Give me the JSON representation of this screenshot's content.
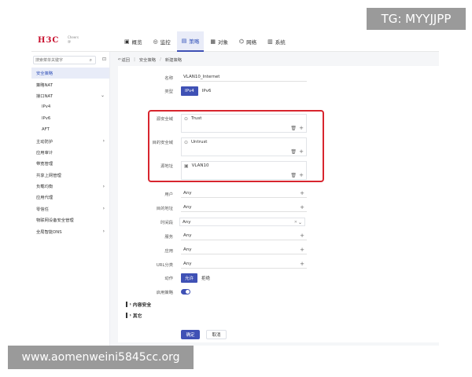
{
  "brand": {
    "logo": "H3C",
    "sub1": "Cheers",
    "sub2": "@"
  },
  "nav": [
    {
      "icon": "▣",
      "label": "概览"
    },
    {
      "icon": "◎",
      "label": "监控"
    },
    {
      "icon": "▤",
      "label": "策略"
    },
    {
      "icon": "▦",
      "label": "对象"
    },
    {
      "icon": "⌬",
      "label": "网络"
    },
    {
      "icon": "▥",
      "label": "系统"
    }
  ],
  "sidebar": {
    "search_placeholder": "搜索菜单关键字",
    "items": [
      {
        "label": "安全策略"
      },
      {
        "label": "策略NAT"
      },
      {
        "label": "接口NAT"
      },
      {
        "label": "IPv4"
      },
      {
        "label": "IPv6"
      },
      {
        "label": "AFT"
      },
      {
        "label": "主动防护"
      },
      {
        "label": "应用审计"
      },
      {
        "label": "带宽管理"
      },
      {
        "label": "共享上网管理"
      },
      {
        "label": "负载均衡"
      },
      {
        "label": "应用代理"
      },
      {
        "label": "零信任"
      },
      {
        "label": "物联网设备安全管理"
      },
      {
        "label": "全局智能DNS"
      }
    ]
  },
  "breadcrumb": {
    "back": "返回",
    "parent": "安全策略",
    "current": "新建策略"
  },
  "form": {
    "name_label": "名称",
    "name_value": "VLAN10_Internet",
    "type_label": "类型",
    "type_opt1": "IPv4",
    "type_opt2": "IPv6",
    "src_zone_label": "源安全域",
    "src_zone_value": "Trust",
    "dst_zone_label": "目的安全域",
    "dst_zone_value": "Untrust",
    "src_addr_label": "源地址",
    "src_addr_value": "VLAN10",
    "user_label": "用户",
    "user_value": "Any",
    "dst_addr_label": "目的地址",
    "dst_addr_value": "Any",
    "time_label": "时间段",
    "time_value": "Any",
    "service_label": "服务",
    "service_value": "Any",
    "app_label": "应用",
    "app_value": "Any",
    "url_label": "URL分类",
    "url_value": "Any",
    "action_label": "动作",
    "action_opt1": "允许",
    "action_opt2": "拒绝",
    "enable_label": "启用策略"
  },
  "sections": {
    "content_security": "内容安全",
    "other": "其它"
  },
  "buttons": {
    "ok": "确定",
    "cancel": "取消"
  },
  "watermarks": {
    "tg": "TG: MYYJJPP",
    "url": "www.aomenweini5845cc.org"
  },
  "colors": {
    "accent": "#3f51b5",
    "highlight": "#d8252e",
    "brand": "#c8102e"
  }
}
